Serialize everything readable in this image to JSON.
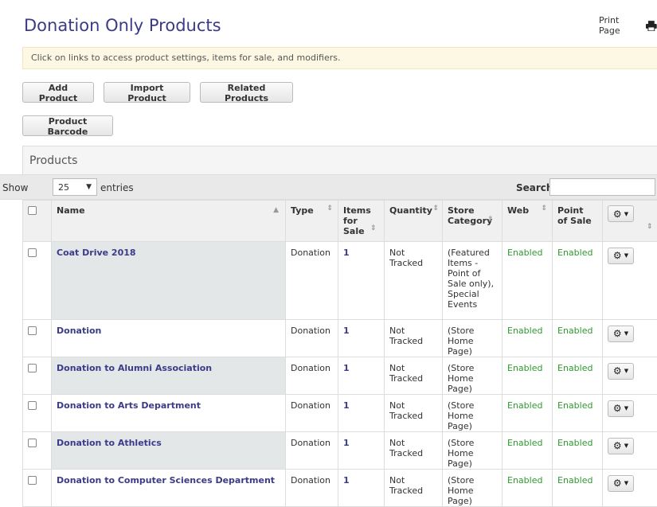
{
  "header": {
    "title": "Donation Only Products",
    "print_label": "Print Page"
  },
  "info": "Click on links to access product settings, items for sale, and modifiers.",
  "toolbar": {
    "add_product": "Add Product",
    "import_product": "Import Product",
    "related_products": "Related Products",
    "product_barcode": "Product Barcode"
  },
  "panel": {
    "title": "Products"
  },
  "controls": {
    "show": "Show",
    "entries_value": "25",
    "entries": "entries",
    "search": "Search:"
  },
  "table": {
    "headers": {
      "name": "Name",
      "type": "Type",
      "items_for_sale": "Items for Sale",
      "quantity": "Quantity",
      "store_category": "Store Category",
      "web": "Web",
      "point_of_sale": "Point of Sale"
    },
    "rows": [
      {
        "name": "Coat Drive 2018",
        "type": "Donation",
        "items": "1",
        "quantity": "Not Tracked",
        "category": "(Featured Items - Point of Sale only), Special Events",
        "web": "Enabled",
        "pos": "Enabled"
      },
      {
        "name": "Donation",
        "type": "Donation",
        "items": "1",
        "quantity": "Not Tracked",
        "category": "(Store Home Page)",
        "web": "Enabled",
        "pos": "Enabled"
      },
      {
        "name": "Donation to Alumni Association",
        "type": "Donation",
        "items": "1",
        "quantity": "Not Tracked",
        "category": "(Store Home Page)",
        "web": "Enabled",
        "pos": "Enabled"
      },
      {
        "name": "Donation to Arts Department",
        "type": "Donation",
        "items": "1",
        "quantity": "Not Tracked",
        "category": "(Store Home Page)",
        "web": "Enabled",
        "pos": "Enabled"
      },
      {
        "name": "Donation to Athletics",
        "type": "Donation",
        "items": "1",
        "quantity": "Not Tracked",
        "category": "(Store Home Page)",
        "web": "Enabled",
        "pos": "Enabled"
      },
      {
        "name": "Donation to Computer Sciences Department",
        "type": "Donation",
        "items": "1",
        "quantity": "Not Tracked",
        "category": "(Store Home Page)",
        "web": "Enabled",
        "pos": "Enabled"
      }
    ]
  },
  "icons": {
    "print": "printer-icon",
    "gear": "gear-icon",
    "caret": "caret-down-icon",
    "sort": "sort-icon"
  },
  "colors": {
    "title": "#3b3b8a",
    "link": "#3b3b8a",
    "enabled": "#2e9a2e",
    "info_bg": "#fcf8e3"
  }
}
